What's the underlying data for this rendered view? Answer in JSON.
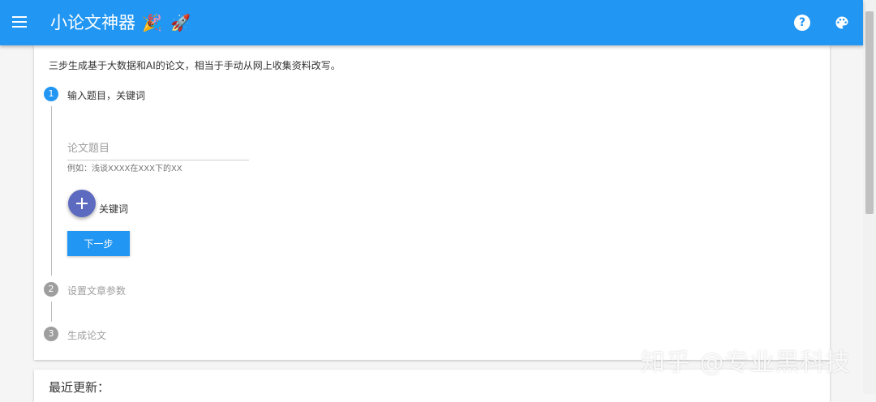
{
  "appbar": {
    "title": "小论文神器",
    "emoji_party": "🎉",
    "emoji_rocket": "🚀",
    "help_glyph": "?",
    "menu_icon": "menu-icon",
    "help_icon": "help-circle-icon",
    "palette_icon": "palette-icon"
  },
  "intro": "三步生成基于大数据和AI的论文，相当于手动从网上收集资料改写。",
  "steps": [
    {
      "number": "1",
      "label": "输入题目，关键词",
      "state": "active"
    },
    {
      "number": "2",
      "label": "设置文章参数",
      "state": "inactive"
    },
    {
      "number": "3",
      "label": "生成论文",
      "state": "inactive"
    }
  ],
  "form": {
    "title_placeholder": "论文题目",
    "title_value": "",
    "title_hint": "例如：浅谈XXXX在XXX下的XX",
    "add_keyword_label": "关键词",
    "next_button": "下一步"
  },
  "recent": {
    "title": "最近更新："
  },
  "watermark": "知乎 @专业黑科技",
  "colors": {
    "primary": "#2196f3",
    "fab": "#5c6bc0",
    "inactive": "#9e9e9e",
    "background": "#f5f5f5"
  }
}
